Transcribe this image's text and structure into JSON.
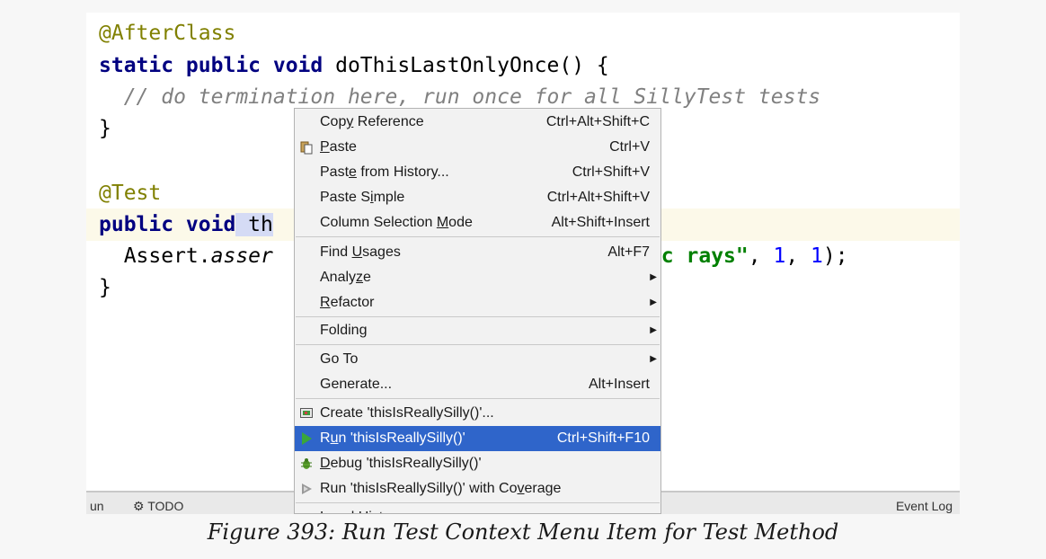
{
  "code": {
    "line1": "@AfterClass",
    "line2_kw": "static public void",
    "line2_rest": " doThisLastOnlyOnce() {",
    "line3": "  // do termination here, run once for all SillyTest tests",
    "line4": "}",
    "line6": "@Test",
    "line7_kw": "public void",
    "line7_sel": " th",
    "line8_pre": "  Assert.",
    "line8_method": "asser",
    "line8_str": "y cosmic rays\"",
    "line8_comma1": ", ",
    "line8_n1": "1",
    "line8_comma2": ", ",
    "line8_n2": "1",
    "line8_end": ");",
    "line9": "}"
  },
  "toolstrip": {
    "run": "un",
    "todo": "⚙ TODO",
    "event_log": "Event Log"
  },
  "menu": {
    "copy_reference": {
      "pre": "Cop",
      "u": "y",
      "post": " Reference",
      "shortcut": "Ctrl+Alt+Shift+C"
    },
    "paste": {
      "pre": "",
      "u": "P",
      "post": "aste",
      "shortcut": "Ctrl+V",
      "icon": "paste-icon"
    },
    "paste_history": {
      "pre": "Past",
      "u": "e",
      "post": " from History...",
      "shortcut": "Ctrl+Shift+V"
    },
    "paste_simple": {
      "pre": "Paste S",
      "u": "i",
      "post": "mple",
      "shortcut": "Ctrl+Alt+Shift+V"
    },
    "column_mode": {
      "pre": "Column Selection ",
      "u": "M",
      "post": "ode",
      "shortcut": "Alt+Shift+Insert"
    },
    "find_usages": {
      "pre": "Find ",
      "u": "U",
      "post": "sages",
      "shortcut": "Alt+F7"
    },
    "analyze": {
      "pre": "Analy",
      "u": "z",
      "post": "e"
    },
    "refactor": {
      "pre": "",
      "u": "R",
      "post": "efactor"
    },
    "folding": {
      "label": "Folding"
    },
    "goto": {
      "label": "Go To"
    },
    "generate": {
      "label": "Generate...",
      "shortcut": "Alt+Insert"
    },
    "create": {
      "label": "Create 'thisIsReallySilly()'...",
      "icon": "create-config-icon"
    },
    "run": {
      "pre": "R",
      "u": "u",
      "post": "n 'thisIsReallySilly()'",
      "shortcut": "Ctrl+Shift+F10",
      "icon": "run-icon"
    },
    "debug": {
      "pre": "",
      "u": "D",
      "post": "ebug 'thisIsReallySilly()'",
      "icon": "debug-icon"
    },
    "coverage": {
      "pre": "Run 'thisIsReallySilly()' with Co",
      "u": "v",
      "post": "erage",
      "icon": "coverage-icon"
    },
    "local_history": {
      "label": "Local History"
    }
  },
  "caption": "Figure 393: Run Test Context Menu Item for Test Method",
  "colors": {
    "menu_highlight": "#2f65ca",
    "run_icon": "#3aa63a",
    "annotation": "#808000",
    "keyword": "#000080",
    "string": "#008000",
    "number": "#0000ff"
  }
}
